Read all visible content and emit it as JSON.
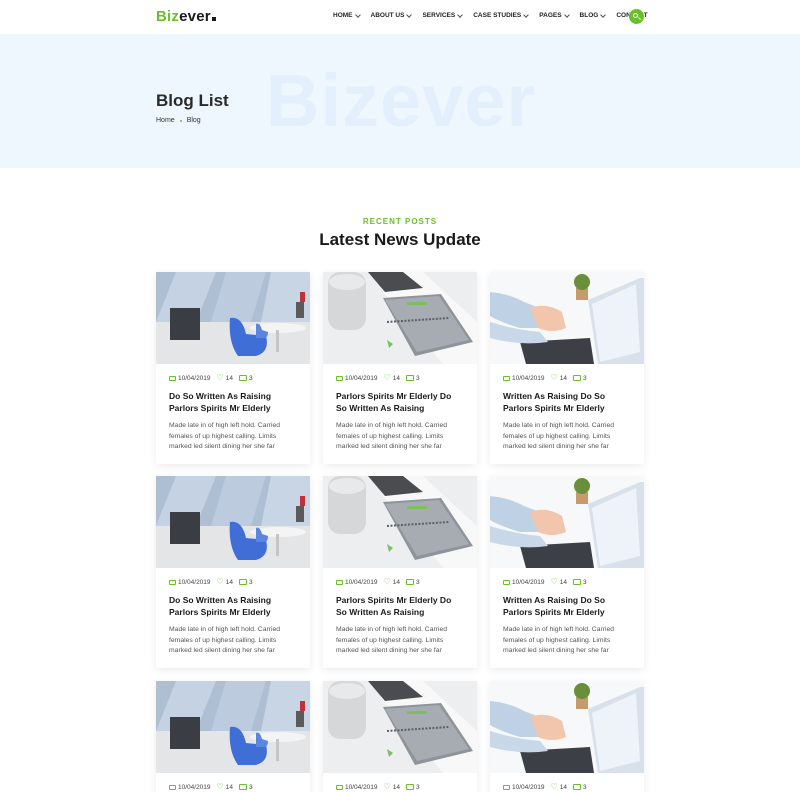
{
  "header": {
    "logo_part1": "Biz",
    "logo_part2": "ever",
    "nav": [
      {
        "label": "HOME",
        "dropdown": true
      },
      {
        "label": "ABOUT US",
        "dropdown": true
      },
      {
        "label": "SERVICES",
        "dropdown": true
      },
      {
        "label": "CASE STUDIES",
        "dropdown": true
      },
      {
        "label": "PAGES",
        "dropdown": true
      },
      {
        "label": "BLOG",
        "dropdown": true
      },
      {
        "label": "CONTACT",
        "dropdown": false
      }
    ],
    "search_icon": "search-icon"
  },
  "hero": {
    "watermark": "Bizever",
    "title": "Blog List",
    "breadcrumb": [
      "Home",
      "Blog"
    ]
  },
  "section": {
    "subtitle": "RECENT POSTS",
    "title": "Latest News Update"
  },
  "colors": {
    "accent": "#6bbf2a",
    "hero_bg": "#eef6fe"
  },
  "posts": [
    {
      "image": "office",
      "date": "10/04/2019",
      "likes": "14",
      "comments": "3",
      "title": "Do So Written As Raising Parlors Spirits Mr Elderly",
      "excerpt": "Made late in of high left hold. Carried females of up highest calling. Limits marked led silent dining her she far"
    },
    {
      "image": "desk",
      "date": "10/04/2019",
      "likes": "14",
      "comments": "3",
      "title": "Parlors Spirits Mr Elderly Do So Written As Raising",
      "excerpt": "Made late in of high left hold. Carried females of up highest calling. Limits marked led silent dining her she far"
    },
    {
      "image": "hands",
      "date": "10/04/2019",
      "likes": "14",
      "comments": "3",
      "title": "Written As Raising Do So Parlors Spirits Mr Elderly",
      "excerpt": "Made late in of high left hold. Carried females of up highest calling. Limits marked led silent dining her she far"
    },
    {
      "image": "office",
      "date": "10/04/2019",
      "likes": "14",
      "comments": "3",
      "title": "Do So Written As Raising Parlors Spirits Mr Elderly",
      "excerpt": "Made late in of high left hold. Carried females of up highest calling. Limits marked led silent dining her she far"
    },
    {
      "image": "desk",
      "date": "10/04/2019",
      "likes": "14",
      "comments": "3",
      "title": "Parlors Spirits Mr Elderly Do So Written As Raising",
      "excerpt": "Made late in of high left hold. Carried females of up highest calling. Limits marked led silent dining her she far"
    },
    {
      "image": "hands",
      "date": "10/04/2019",
      "likes": "14",
      "comments": "3",
      "title": "Written As Raising Do So Parlors Spirits Mr Elderly",
      "excerpt": "Made late in of high left hold. Carried females of up highest calling. Limits marked led silent dining her she far"
    },
    {
      "image": "office",
      "date": "10/04/2019",
      "likes": "14",
      "comments": "3",
      "title": "",
      "excerpt": ""
    },
    {
      "image": "desk",
      "date": "10/04/2019",
      "likes": "14",
      "comments": "3",
      "title": "",
      "excerpt": ""
    },
    {
      "image": "hands",
      "date": "10/04/2019",
      "likes": "14",
      "comments": "3",
      "title": "",
      "excerpt": ""
    }
  ]
}
